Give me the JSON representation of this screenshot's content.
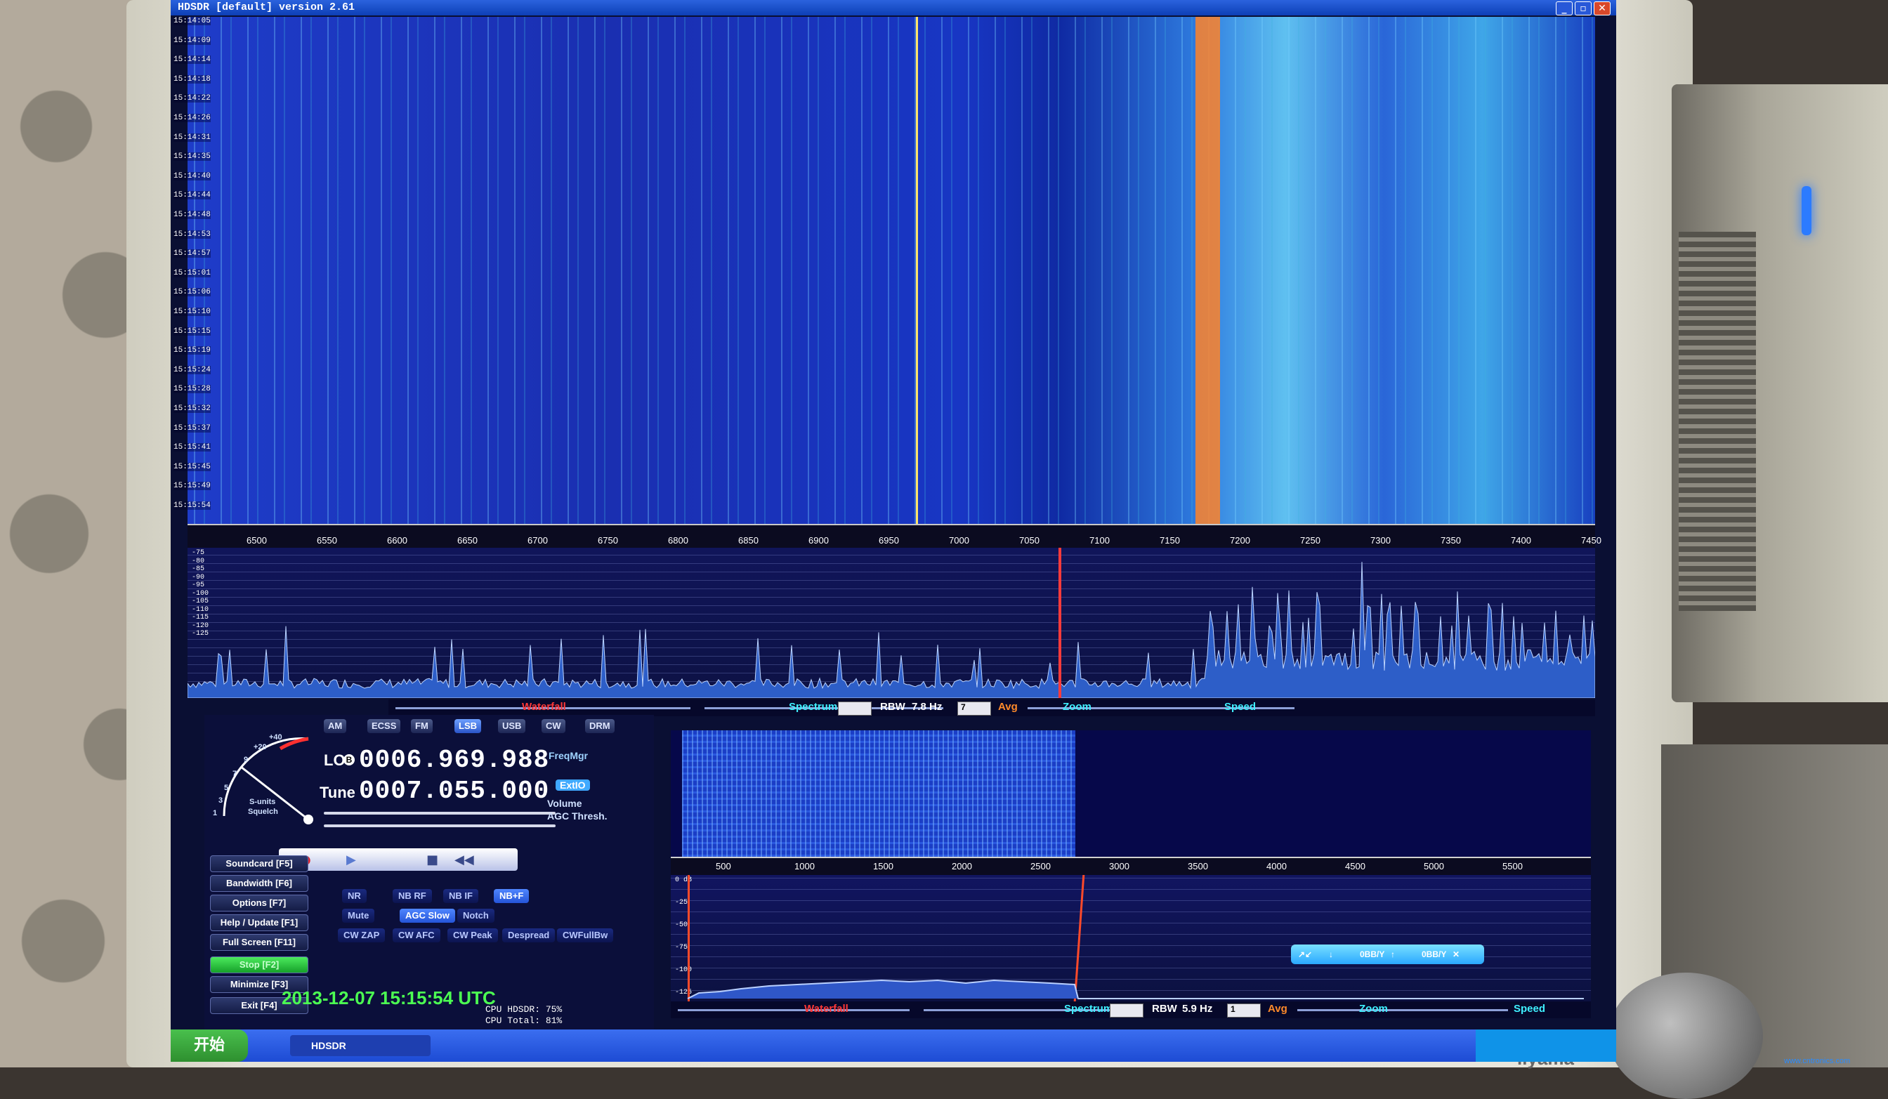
{
  "window": {
    "title": "HDSDR [default]  version 2.61",
    "buttons": [
      "_",
      "▫",
      "✕"
    ]
  },
  "waterfall": {
    "timestamps": [
      "15:14:05",
      "15:14:09",
      "15:14:14",
      "15:14:18",
      "15:14:22",
      "15:14:26",
      "15:14:31",
      "15:14:35",
      "15:14:40",
      "15:14:44",
      "15:14:48",
      "15:14:53",
      "15:14:57",
      "15:15:01",
      "15:15:06",
      "15:15:10",
      "15:15:15",
      "15:15:19",
      "15:15:24",
      "15:15:28",
      "15:15:32",
      "15:15:37",
      "15:15:41",
      "15:15:45",
      "15:15:49",
      "15:15:54"
    ],
    "freq_axis": [
      "6500",
      "6550",
      "6600",
      "6650",
      "6700",
      "6750",
      "6800",
      "6850",
      "6900",
      "6950",
      "7000",
      "7050",
      "7100",
      "7150",
      "7200",
      "7250",
      "7300",
      "7350",
      "7400",
      "7450"
    ]
  },
  "spectrum": {
    "db_ticks": [
      "-75",
      "-80",
      "-85",
      "-90",
      "-95",
      "-100",
      "-105",
      "-110",
      "-115",
      "-120",
      "-125"
    ],
    "controls": {
      "waterfall": "Waterfall",
      "spectrum": "Spectrum",
      "rbw_label": "RBW",
      "rbw_value": "7.8 Hz",
      "avg": "Avg",
      "zoom": "Zoom",
      "speed": "Speed",
      "avg_value": "7"
    },
    "colors": {
      "waterfall_label": "#ff3838",
      "spectrum_label": "#3ff0ff",
      "avg_label": "#ff8a2a"
    }
  },
  "panel": {
    "modes": [
      "AM",
      "ECSS",
      "FM",
      "LSB",
      "USB",
      "CW",
      "DRM"
    ],
    "active_mode": "LSB",
    "smeter_labels": [
      "S-units",
      "Squelch",
      "+20",
      "+40",
      "9",
      "7",
      "5",
      "3",
      "1"
    ],
    "lo_label": "LO",
    "lo_badge": "B",
    "lo_value": "0006.969.988",
    "tune_label": "Tune",
    "tune_value": "0007.055.000",
    "freqmgr": "FreqMgr",
    "extio": "ExtIO",
    "volume": "Volume",
    "agc_thresh": "AGC Thresh.",
    "transport": [
      "●",
      "▶",
      "",
      "■",
      "◀◀",
      ""
    ],
    "side_buttons": [
      "Soundcard [F5]",
      "Bandwidth [F6]",
      "Options [F7]",
      "Help / Update [F1]",
      "Full Screen [F11]",
      "Stop [F2]",
      "Minimize [F3]",
      "Exit [F4]"
    ],
    "dsp_row1": [
      "NR",
      "NB RF",
      "NB IF",
      "NB+F"
    ],
    "dsp_row2": [
      "Mute",
      "AGC Slow",
      "Notch"
    ],
    "dsp_row3": [
      "CW ZAP",
      "CW AFC",
      "CW Peak",
      "Despread",
      "CWFullBw"
    ],
    "date": "2013-12-07",
    "time": "15:15:54 UTC",
    "cpu_hdsdr": "CPU HDSDR: 75%",
    "cpu_total": "CPU Total: 81%"
  },
  "audio": {
    "freq_axis": [
      "500",
      "1000",
      "1500",
      "2000",
      "2500",
      "3000",
      "3500",
      "4000",
      "4500",
      "5000",
      "5500"
    ],
    "db_ticks": [
      "0 dB",
      "-25",
      "-50",
      "-75",
      "-100",
      "-125"
    ],
    "controls": {
      "waterfall": "Waterfall",
      "spectrum": "Spectrum",
      "rbw_label": "RBW",
      "rbw_value": "5.9 Hz",
      "avg": "Avg",
      "zoom": "Zoom",
      "speed": "Speed",
      "avg_value": "1"
    },
    "tool_strip": [
      "↗↙",
      "↓",
      "0BB/Y",
      "↑",
      "0BB/Y",
      "✕"
    ]
  },
  "taskbar": {
    "start": "开始",
    "task": "HDSDR"
  },
  "monitor_brand": "iiyama",
  "watermark": "www.cntronics.com"
}
